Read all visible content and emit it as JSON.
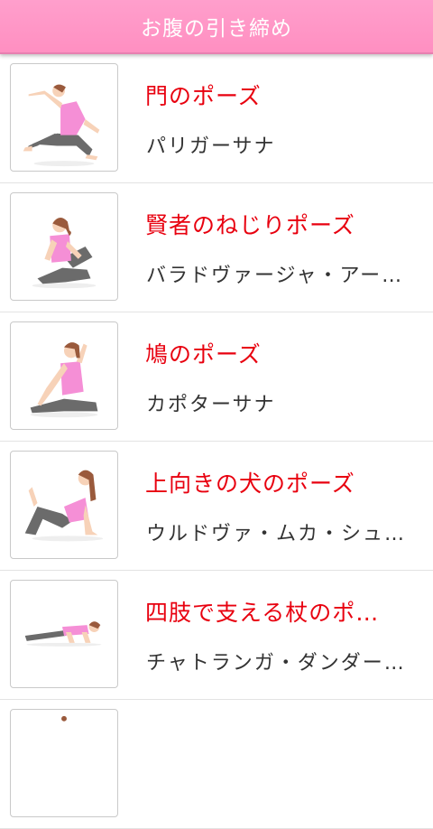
{
  "header": {
    "title": "お腹の引き締め"
  },
  "poses": [
    {
      "title": "門のポーズ",
      "subtitle": "パリガーサナ",
      "icon": "yoga-gate-pose-icon"
    },
    {
      "title": "賢者のねじりポーズ",
      "subtitle": "バラドヴァージャ・アー…",
      "icon": "yoga-sage-twist-icon"
    },
    {
      "title": "鳩のポーズ",
      "subtitle": "カポターサナ",
      "icon": "yoga-pigeon-pose-icon"
    },
    {
      "title": "上向きの犬のポーズ",
      "subtitle": "ウルドヴァ・ムカ・シュ…",
      "icon": "yoga-upward-dog-icon"
    },
    {
      "title": "四肢で支える杖のポ…",
      "subtitle": "チャトランガ・ダンダー…",
      "icon": "yoga-four-limbed-staff-icon"
    },
    {
      "title": "",
      "subtitle": "",
      "icon": "yoga-pose-icon"
    }
  ],
  "colors": {
    "header": "#ff96c6",
    "title": "#e8000f",
    "subtitle": "#333333",
    "skin": "#f7d2b8",
    "top": "#f58fd6",
    "pants": "#6b6b6b",
    "hair": "#9a5a3c"
  }
}
